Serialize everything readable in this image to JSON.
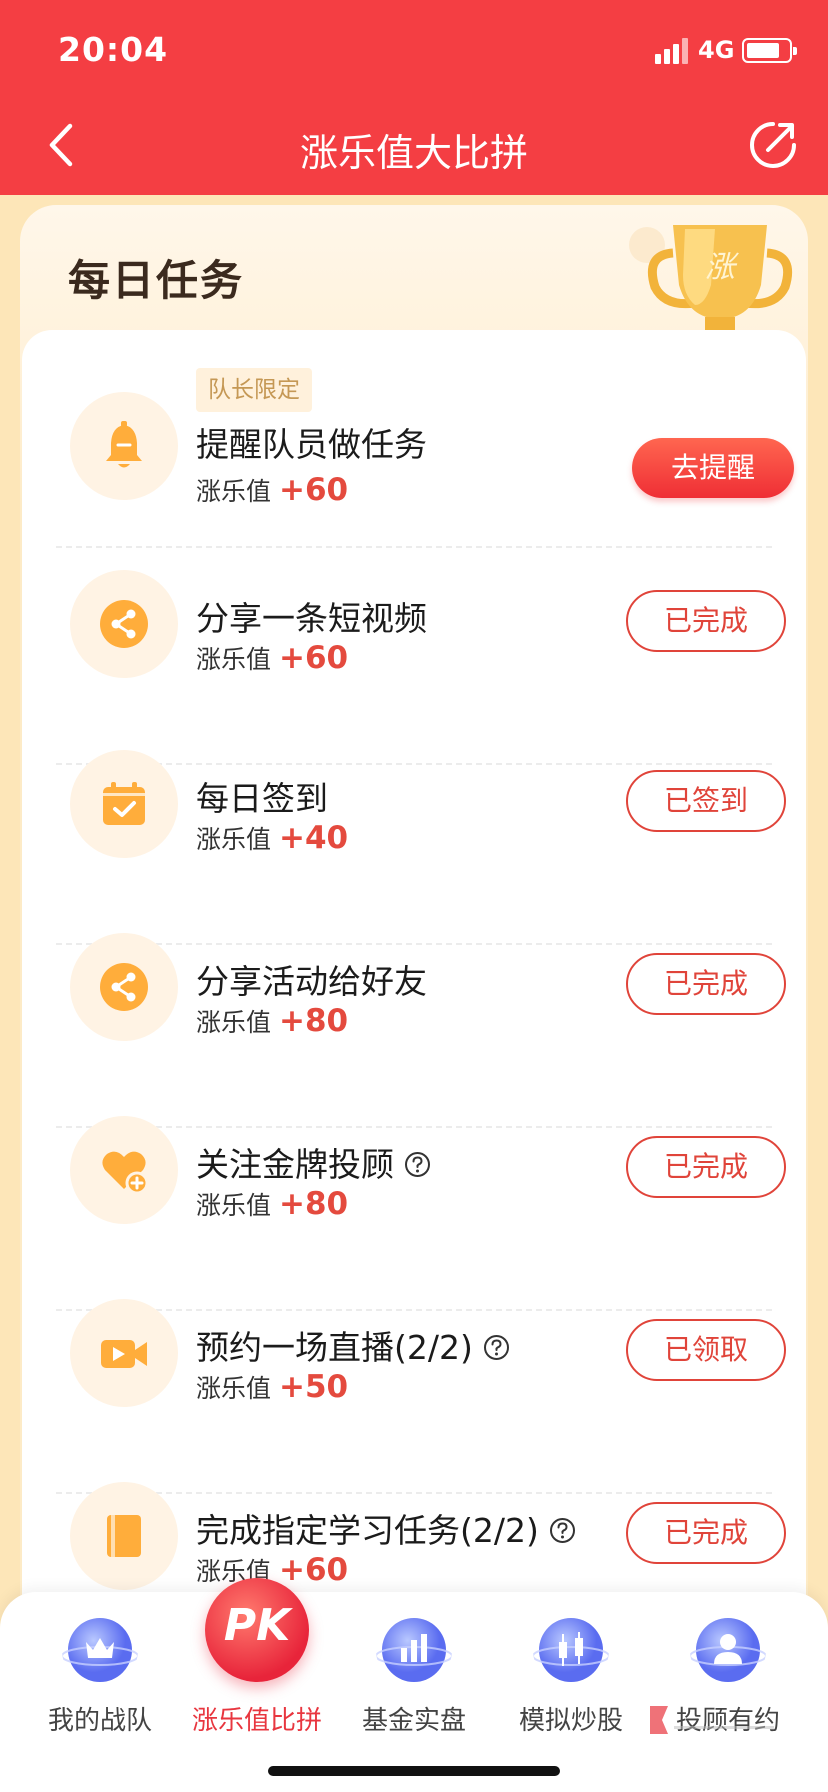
{
  "status_bar": {
    "time": "20:04",
    "network": "4G"
  },
  "nav": {
    "title": "涨乐值大比拼"
  },
  "card": {
    "title": "每日任务",
    "trophy_char": "涨"
  },
  "tasks": [
    {
      "badge": "队长限定",
      "name": "提醒队员做任务",
      "reward_label": "涨乐值",
      "points": "+60",
      "action": "去提醒",
      "icon": "bell-icon"
    },
    {
      "name": "分享一条短视频",
      "reward_label": "涨乐值",
      "points": "+60",
      "action": "已完成",
      "icon": "share-icon"
    },
    {
      "name": "每日签到",
      "reward_label": "涨乐值",
      "points": "+40",
      "action": "已签到",
      "icon": "calendar-check-icon"
    },
    {
      "name": "分享活动给好友",
      "reward_label": "涨乐值",
      "points": "+80",
      "action": "已完成",
      "icon": "share-icon"
    },
    {
      "name": "关注金牌投顾",
      "reward_label": "涨乐值",
      "points": "+80",
      "action": "已完成",
      "icon": "heart-plus-icon",
      "help": true
    },
    {
      "name": "预约一场直播(2/2)",
      "reward_label": "涨乐值",
      "points": "+50",
      "action": "已领取",
      "icon": "video-icon",
      "help": true
    },
    {
      "name": "完成指定学习任务(2/2)",
      "reward_label": "涨乐值",
      "points": "+60",
      "action": "已完成",
      "icon": "book-icon",
      "help": true
    }
  ],
  "tabbar": {
    "items": [
      {
        "label": "我的战队"
      },
      {
        "label": "涨乐值比拼",
        "icon_text": "PK"
      },
      {
        "label": "基金实盘"
      },
      {
        "label": "模拟炒股"
      },
      {
        "label": "投顾有约"
      }
    ]
  },
  "colors": {
    "primary": "#f43e43",
    "accent": "#e0443a",
    "icon_orange": "#ffad3b"
  }
}
